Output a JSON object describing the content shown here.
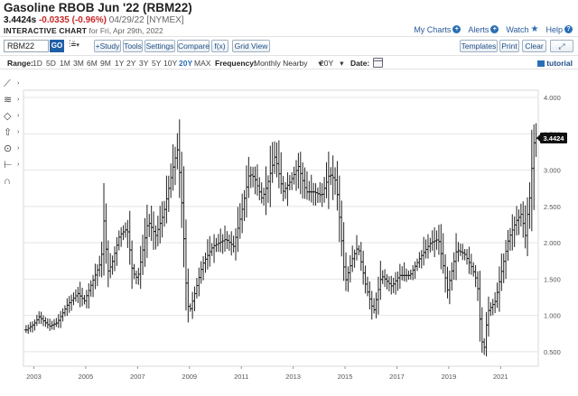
{
  "header": {
    "title": "Gasoline RBOB Jun '22 (RBM22)",
    "last": "3.4424s",
    "change": "-0.0335 (-0.96%)",
    "date_exchange": "04/29/22 [NYMEX]",
    "subtitle_bold": "INTERACTIVE CHART",
    "subtitle_rest": " for Fri, Apr 29th, 2022"
  },
  "top_links": {
    "my_charts": "My Charts",
    "alerts": "Alerts",
    "watch": "Watch",
    "help": "Help"
  },
  "toolbar": {
    "symbol_value": "RBM22",
    "go_label": "GO",
    "bar_type_glyph": "⫶≚",
    "buttons": [
      "+Study",
      "Tools",
      "Settings",
      "Compare",
      "f(x)",
      "Grid View"
    ],
    "right_buttons": [
      "Templates",
      "Print",
      "Clear"
    ]
  },
  "range_bar": {
    "range_label": "Range:",
    "ranges": [
      "1D",
      "5D",
      "1M",
      "3M",
      "6M",
      "9M",
      "1Y",
      "2Y",
      "3Y",
      "5Y",
      "10Y",
      "20Y",
      "MAX"
    ],
    "active_range": "20Y",
    "frequency_label": "Frequency:",
    "frequency_value": "Monthly Nearby",
    "period_value": "20Y",
    "date_label": "Date:",
    "tutorial_label": "tutorial"
  },
  "drawing_tools": [
    "line-tool-icon",
    "fibonacci-tool-icon",
    "shape-tool-icon",
    "arrow-tool-icon",
    "marker-tool-icon",
    "measure-tool-icon",
    "magnet-tool-icon"
  ],
  "colors": {
    "accent": "#2a6fb5",
    "negative": "#c62828",
    "bar": "#222222",
    "last_price_tag": "#111111"
  },
  "chart_data": {
    "type": "ohlc",
    "frequency": "monthly",
    "x_tick_labels": [
      "2003",
      "2005",
      "2007",
      "2009",
      "2011",
      "2013",
      "2015",
      "2017",
      "2019",
      "2021"
    ],
    "y_tick_labels": [
      "0.500",
      "1.000",
      "1.500",
      "2.000",
      "2.500",
      "3.000",
      "3.500",
      "4.000"
    ],
    "ylim": [
      0.3,
      4.1
    ],
    "xlim": [
      2002.6,
      2022.45
    ],
    "grid": "horizontal",
    "last_price_tag": "3.4424",
    "last_price": 3.4424,
    "anchors": [
      [
        2002.7,
        0.8
      ],
      [
        2003.0,
        0.88
      ],
      [
        2003.2,
        0.98
      ],
      [
        2003.6,
        0.85
      ],
      [
        2003.9,
        0.9
      ],
      [
        2004.3,
        1.15
      ],
      [
        2004.7,
        1.3
      ],
      [
        2004.95,
        1.2
      ],
      [
        2005.3,
        1.5
      ],
      [
        2005.6,
        1.75
      ],
      [
        2005.7,
        2.3
      ],
      [
        2005.85,
        1.6
      ],
      [
        2006.0,
        1.7
      ],
      [
        2006.3,
        2.1
      ],
      [
        2006.6,
        2.2
      ],
      [
        2006.8,
        1.6
      ],
      [
        2007.0,
        1.5
      ],
      [
        2007.4,
        2.3
      ],
      [
        2007.7,
        2.1
      ],
      [
        2008.0,
        2.4
      ],
      [
        2008.4,
        3.1
      ],
      [
        2008.55,
        3.3
      ],
      [
        2008.75,
        2.3
      ],
      [
        2008.9,
        1.2
      ],
      [
        2009.0,
        1.05
      ],
      [
        2009.2,
        1.3
      ],
      [
        2009.5,
        1.7
      ],
      [
        2009.9,
        1.95
      ],
      [
        2010.4,
        2.05
      ],
      [
        2010.7,
        1.95
      ],
      [
        2011.0,
        2.4
      ],
      [
        2011.3,
        2.95
      ],
      [
        2011.5,
        2.9
      ],
      [
        2011.8,
        2.6
      ],
      [
        2012.0,
        2.8
      ],
      [
        2012.3,
        3.2
      ],
      [
        2012.6,
        2.7
      ],
      [
        2012.9,
        2.85
      ],
      [
        2013.2,
        3.05
      ],
      [
        2013.5,
        2.7
      ],
      [
        2013.8,
        2.7
      ],
      [
        2014.1,
        2.65
      ],
      [
        2014.4,
        2.95
      ],
      [
        2014.65,
        2.85
      ],
      [
        2014.85,
        2.1
      ],
      [
        2015.0,
        1.45
      ],
      [
        2015.3,
        1.8
      ],
      [
        2015.5,
        1.95
      ],
      [
        2015.8,
        1.4
      ],
      [
        2016.1,
        1.05
      ],
      [
        2016.4,
        1.55
      ],
      [
        2016.8,
        1.4
      ],
      [
        2017.1,
        1.55
      ],
      [
        2017.5,
        1.55
      ],
      [
        2017.9,
        1.8
      ],
      [
        2018.3,
        2.0
      ],
      [
        2018.6,
        2.05
      ],
      [
        2018.95,
        1.35
      ],
      [
        2019.3,
        1.9
      ],
      [
        2019.6,
        1.85
      ],
      [
        2019.9,
        1.65
      ],
      [
        2020.1,
        1.45
      ],
      [
        2020.25,
        0.7
      ],
      [
        2020.35,
        0.5
      ],
      [
        2020.5,
        1.05
      ],
      [
        2020.8,
        1.2
      ],
      [
        2021.0,
        1.55
      ],
      [
        2021.3,
        2.05
      ],
      [
        2021.6,
        2.3
      ],
      [
        2021.8,
        2.4
      ],
      [
        2021.95,
        2.1
      ],
      [
        2022.05,
        2.45
      ],
      [
        2022.15,
        2.7
      ],
      [
        2022.25,
        3.35
      ],
      [
        2022.37,
        3.44
      ]
    ]
  }
}
